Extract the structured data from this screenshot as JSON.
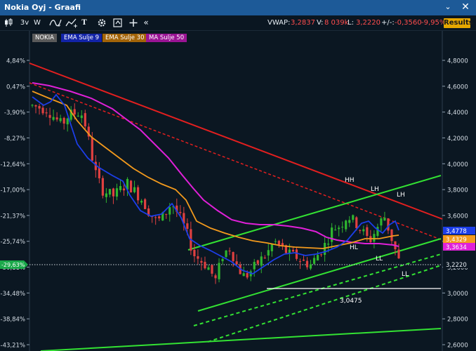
{
  "window": {
    "title": "Nokia Oyj - Graafi",
    "minimize_glyph": "⌄",
    "close_glyph": "✕"
  },
  "toolbar": {
    "period_label": "3v",
    "interval_label": "W",
    "text_tool_label": "T",
    "collapse_label": "«",
    "results_label": "Results"
  },
  "quote": {
    "vwap_label": "VWAP:",
    "vwap_value": "3,2837",
    "volume_label": "V:",
    "volume_value": "8 039k",
    "last_label": "L:",
    "last_value": "3,2220",
    "change_label": "+/-:",
    "change_value": "-0,3560",
    "change_pct": "-9,95%"
  },
  "legend": [
    {
      "label": "NOKIA",
      "color": "#9e9e9e"
    },
    {
      "label": "EMA Sulje 9",
      "color": "#2244ee"
    },
    {
      "label": "EMA Sulje 30",
      "color": "#f39a1d"
    },
    {
      "label": "MA Sulje 50",
      "color": "#e020d8"
    }
  ],
  "chart_data": {
    "type": "candlestick",
    "y_right_ticks": [
      "4,8000",
      "4,6000",
      "4,4000",
      "4,2000",
      "4,0000",
      "3,8000",
      "3,6000",
      "3,4000",
      "3,2000",
      "3,0000",
      "2,8000",
      "2,6000"
    ],
    "y_right_values": [
      4.8,
      4.6,
      4.4,
      4.2,
      4.0,
      3.8,
      3.6,
      3.4,
      3.2,
      3.0,
      2.8,
      2.6
    ],
    "y_left_ticks": [
      "4,84%",
      "0,47%",
      "-3,90%",
      "-8,27%",
      "-12,64%",
      "-17,00%",
      "-21,37%",
      "-25,74%",
      "-30,11%",
      "-34,48%",
      "-38,84%",
      "-43,21%"
    ],
    "ylim": [
      2.6,
      4.8
    ],
    "current_price_label": "3,2220",
    "current_pct_label": "-29,63%",
    "price_tags": [
      {
        "label": "3,4778",
        "value": 3.4778,
        "color": "#1c3ee8"
      },
      {
        "label": "3,4329",
        "value": 3.4329,
        "color": "#f39a1d"
      },
      {
        "label": "3,3634",
        "value": 3.3634,
        "color": "#e020d8"
      }
    ],
    "support_level": {
      "label": "3,0475",
      "value": 3.0475
    },
    "annotations": [
      "HH",
      "LH",
      "LH",
      "HL",
      "LL",
      "LL"
    ]
  }
}
